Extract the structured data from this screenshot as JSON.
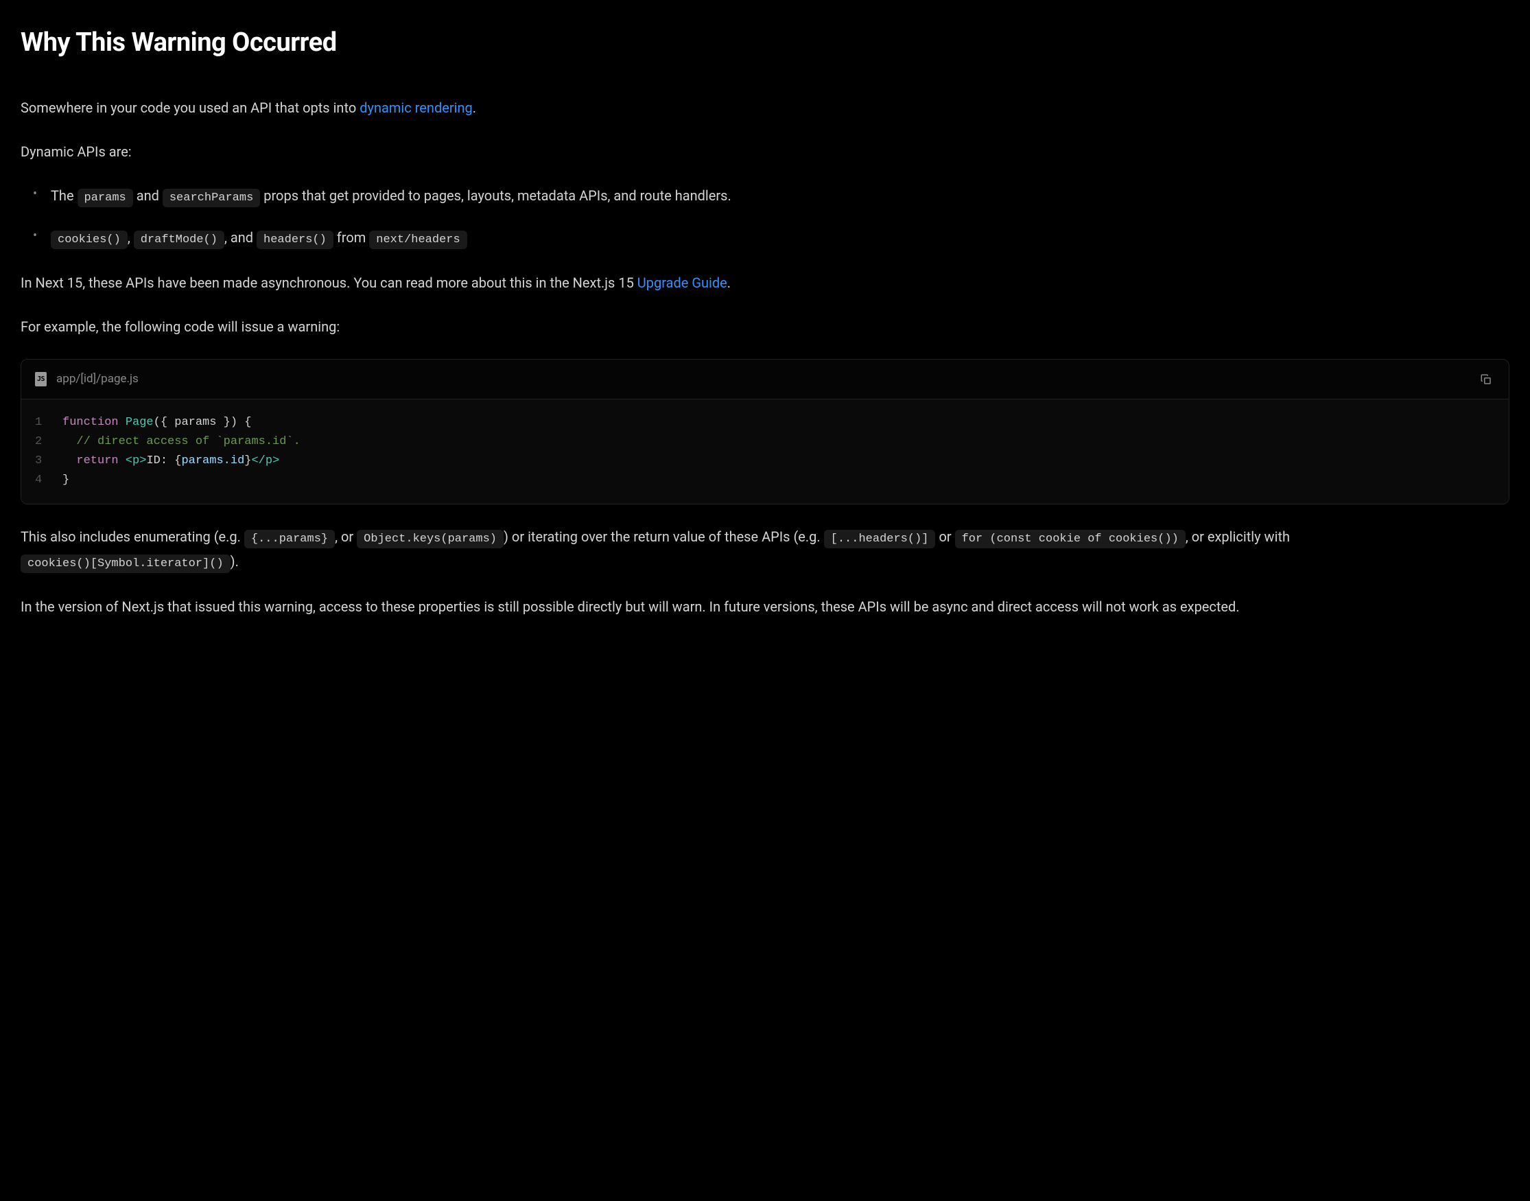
{
  "heading": "Why This Warning Occurred",
  "intro": {
    "text_before_link": "Somewhere in your code you used an API that opts into ",
    "link_text": "dynamic rendering",
    "text_after_link": "."
  },
  "dynamic_apis_label": "Dynamic APIs are:",
  "list_item_1": {
    "prefix": "The ",
    "code1": "params",
    "mid1": " and ",
    "code2": "searchParams",
    "suffix": " props that get provided to pages, layouts, metadata APIs, and route handlers."
  },
  "list_item_2": {
    "code1": "cookies()",
    "sep1": ", ",
    "code2": "draftMode()",
    "sep2": ", and ",
    "code3": "headers()",
    "mid": " from ",
    "code4": "next/headers"
  },
  "next15_para": {
    "text_before_link": "In Next 15, these APIs have been made asynchronous. You can read more about this in the Next.js 15 ",
    "link_text": "Upgrade Guide",
    "text_after_link": "."
  },
  "example_intro": "For example, the following code will issue a warning:",
  "code_block": {
    "filename": "app/[id]/page.js",
    "badge": "JS",
    "lines": {
      "l1": {
        "num": "1",
        "kw": "function",
        "fn": "Page",
        "rest": "({ params }) {"
      },
      "l2": {
        "num": "2",
        "comment": "  // direct access of `params.id`."
      },
      "l3": {
        "num": "3",
        "ret": "  return ",
        "tag_open": "<p>",
        "text": "ID: {",
        "prop": "params.id",
        "text2": "}",
        "tag_close": "</p>"
      },
      "l4": {
        "num": "4",
        "brace": "}"
      }
    }
  },
  "enumerating_para": {
    "p1": "This also includes enumerating (e.g. ",
    "code1": "{...params}",
    "p2": ", or ",
    "code2": "Object.keys(params)",
    "p3": ") or iterating over the return value of these APIs (e.g. ",
    "code3": "[...headers()]",
    "p4": " or ",
    "code4": "for (const cookie of cookies())",
    "p5": ", or explicitly with ",
    "code5": "cookies()[Symbol.iterator]()",
    "p6": ")."
  },
  "final_para": "In the version of Next.js that issued this warning, access to these properties is still possible directly but will warn. In future versions, these APIs will be async and direct access will not work as expected."
}
